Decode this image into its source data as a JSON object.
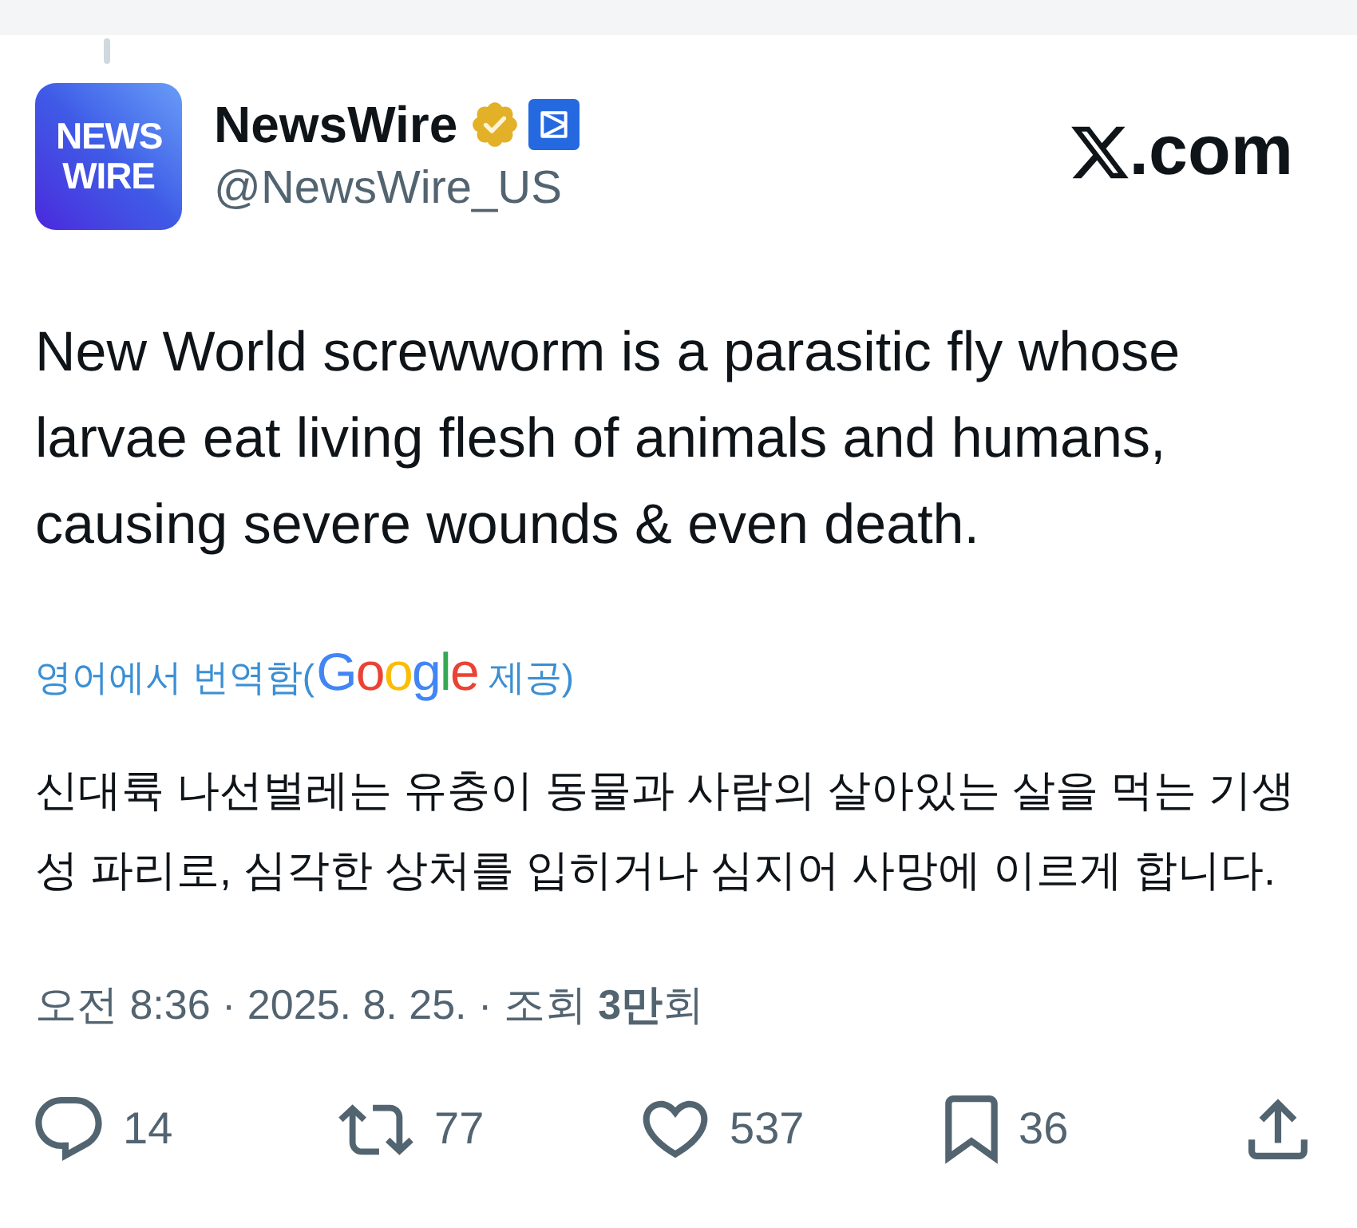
{
  "author": {
    "avatar_text": "NEWS WIRE",
    "name": "NewsWire",
    "verified": true,
    "affiliate_badge": true,
    "handle": "@NewsWire_US"
  },
  "brand": {
    "text": ".com"
  },
  "post": {
    "text": "New World screwworm is a parasitic fly whose larvae eat living flesh of animals and humans, causing severe wounds & even death."
  },
  "translation": {
    "label": "영어에서 번역함(",
    "provider": "Google",
    "label_end": "제공)",
    "text": "신대륙 나선벌레는 유충이 동물과 사람의 살아있는 살을 먹는 기생성 파리로, 심각한 상처를 입히거나 심지어 사망에 이르게 합니다."
  },
  "meta": "오전 8:36 · 2025. 8. 25. · 조회 **3만**회",
  "actions": [
    {
      "kind": "reply",
      "count": "14"
    },
    {
      "kind": "repost",
      "count": "77"
    },
    {
      "kind": "like",
      "count": "537"
    },
    {
      "kind": "bookmark",
      "count": "36"
    },
    {
      "kind": "share"
    }
  ]
}
